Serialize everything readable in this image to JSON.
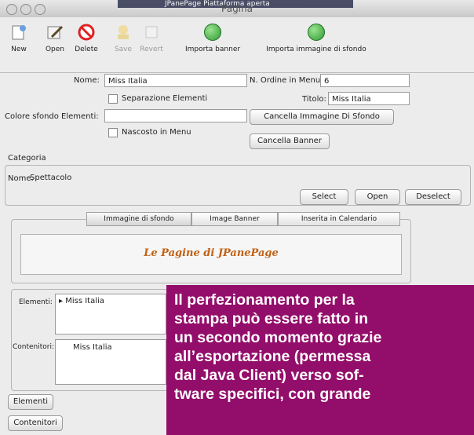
{
  "background_bar": "JPanePage Piattaforma aperta",
  "window": {
    "title": "Pagina"
  },
  "toolbar": {
    "new": "New",
    "open": "Open",
    "delete": "Delete",
    "save": "Save",
    "revert": "Revert",
    "import_banner": "Importa banner",
    "import_background": "Importa immagine di sfondo"
  },
  "form": {
    "nome_label": "Nome:",
    "nome_value": "Miss Italia",
    "ordine_label": "N. Ordine in Menu:",
    "ordine_value": "6",
    "separazione_label": "Separazione Elementi",
    "titolo_label": "Titolo:",
    "titolo_value": "Miss Italia",
    "colore_label": "Colore sfondo Elementi:",
    "colore_value": "",
    "cancella_sfondo": "Cancella Immagine Di Sfondo",
    "nascosto_label": "Nascosto in Menu",
    "cancella_banner": "Cancella Banner"
  },
  "categoria": {
    "title": "Categoria",
    "nome_label": "Nome:",
    "nome_value": "Spettacolo",
    "select": "Select",
    "open": "Open",
    "deselect": "Deselect"
  },
  "tabs": [
    "Immagine di sfondo",
    "Image Banner",
    "Inserita in Calendario"
  ],
  "banner_text": "Le Pagine di JPanePage",
  "lists": {
    "elementi_label": "Elementi:",
    "elementi_item": "Miss Italia",
    "contenitori_label": "Contenitori:",
    "contenitori_item": "Miss Italia"
  },
  "bottom_buttons": {
    "elementi": "Elementi",
    "contenitori": "Contenitori"
  },
  "overlay_lines": [
    "Il  perfezionamento  per  la",
    "stampa può essere fatto in",
    "un secondo momento grazie",
    "all’esportazione (permessa",
    "dal Java Client) verso sof-",
    "tware specifici, con grande"
  ],
  "colors": {
    "overlay": "#930d6a",
    "banner_text": "#c06014"
  }
}
